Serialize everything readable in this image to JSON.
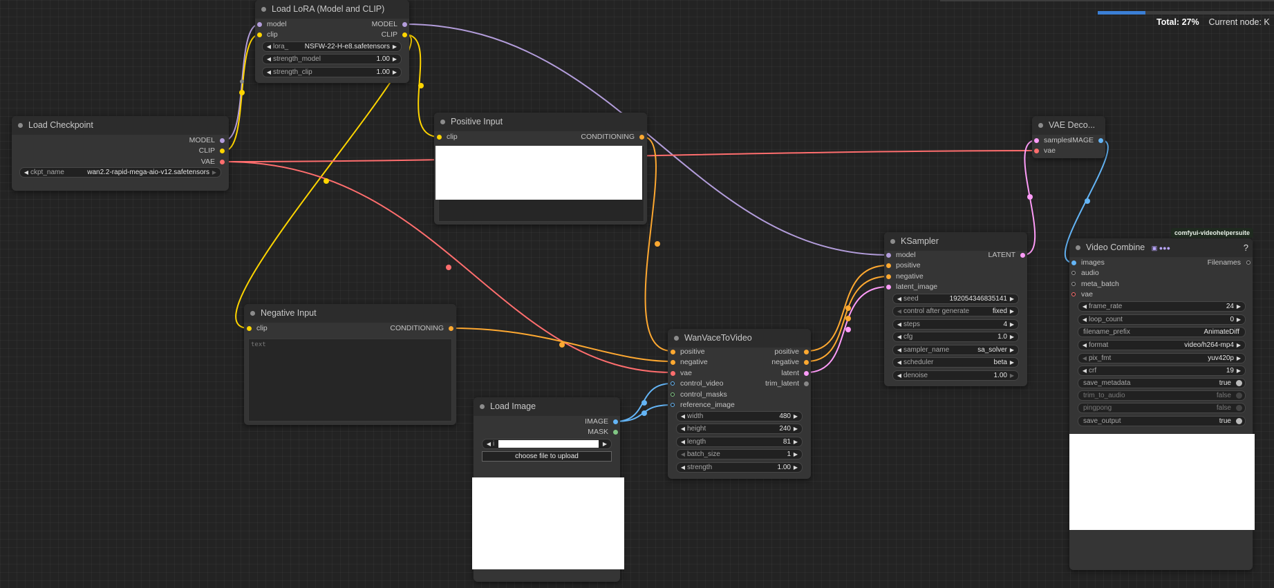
{
  "progress": {
    "total_label": "Total:",
    "total_value": "27%",
    "fraction": 0.27,
    "current_node_label": "Current node: K"
  },
  "colors": {
    "model": "#b39ddb",
    "clip": "#ffd500",
    "vae": "#ff6e6e",
    "conditioning": "#ffa931",
    "latent": "#ff9cf9",
    "image": "#64b5f6",
    "mask": "#81c784"
  },
  "nodes": {
    "load_checkpoint": {
      "title": "Load Checkpoint",
      "outputs": [
        "MODEL",
        "CLIP",
        "VAE"
      ],
      "widgets": [
        {
          "name": "ckpt_name",
          "value": "wan2.2-rapid-mega-aio-v12.safetensors"
        }
      ]
    },
    "load_lora": {
      "title": "Load LoRA (Model and CLIP)",
      "inputs": [
        "model",
        "clip"
      ],
      "outputs": [
        "MODEL",
        "CLIP"
      ],
      "widgets": [
        {
          "name": "lora_",
          "value": "NSFW-22-H-e8.safetensors"
        },
        {
          "name": "strength_model",
          "value": "1.00"
        },
        {
          "name": "strength_clip",
          "value": "1.00"
        }
      ]
    },
    "positive_input": {
      "title": "Positive Input",
      "inputs": [
        "clip"
      ],
      "outputs": [
        "CONDITIONING"
      ]
    },
    "negative_input": {
      "title": "Negative Input",
      "inputs": [
        "clip"
      ],
      "outputs": [
        "CONDITIONING"
      ],
      "text_placeholder": "text"
    },
    "load_image": {
      "title": "Load Image",
      "outputs": [
        "IMAGE",
        "MASK"
      ],
      "widgets": [
        {
          "name": "i",
          "value": ""
        }
      ],
      "upload_button": "choose file to upload"
    },
    "wan_vace": {
      "title": "WanVaceToVideo",
      "inputs": [
        "positive",
        "negative",
        "vae",
        "control_video",
        "control_masks",
        "reference_image"
      ],
      "outputs": [
        "positive",
        "negative",
        "latent",
        "trim_latent"
      ],
      "widgets": [
        {
          "name": "width",
          "value": "480"
        },
        {
          "name": "height",
          "value": "240"
        },
        {
          "name": "length",
          "value": "81"
        },
        {
          "name": "batch_size",
          "value": "1"
        },
        {
          "name": "strength",
          "value": "1.00"
        }
      ]
    },
    "ksampler": {
      "title": "KSampler",
      "inputs": [
        "model",
        "positive",
        "negative",
        "latent_image"
      ],
      "outputs": [
        "LATENT"
      ],
      "widgets": [
        {
          "name": "seed",
          "value": "192054346835141"
        },
        {
          "name": "control after generate",
          "value": "fixed"
        },
        {
          "name": "steps",
          "value": "4"
        },
        {
          "name": "cfg",
          "value": "1.0"
        },
        {
          "name": "sampler_name",
          "value": "sa_solver"
        },
        {
          "name": "scheduler",
          "value": "beta"
        },
        {
          "name": "denoise",
          "value": "1.00"
        }
      ]
    },
    "vae_decode": {
      "title": "VAE Deco...",
      "inputs": [
        "samples",
        "vae"
      ],
      "outputs": [
        "IMAGE"
      ]
    },
    "video_combine": {
      "title": "Video Combine",
      "title_icons": "▣ ●●●",
      "help": "?",
      "badge": "comfyui-videohelpersuite",
      "inputs": [
        "images",
        "audio",
        "meta_batch",
        "vae"
      ],
      "outputs": [
        "Filenames"
      ],
      "widgets": [
        {
          "name": "frame_rate",
          "value": "24"
        },
        {
          "name": "loop_count",
          "value": "0"
        },
        {
          "name": "filename_prefix",
          "value": "AnimateDiff"
        },
        {
          "name": "format",
          "value": "video/h264-mp4"
        },
        {
          "name": "pix_fmt",
          "value": "yuv420p"
        },
        {
          "name": "crf",
          "value": "19"
        },
        {
          "name": "save_metadata",
          "value": "true"
        },
        {
          "name": "trim_to_audio",
          "value": "false"
        },
        {
          "name": "pingpong",
          "value": "false"
        },
        {
          "name": "save_output",
          "value": "true"
        }
      ]
    }
  }
}
